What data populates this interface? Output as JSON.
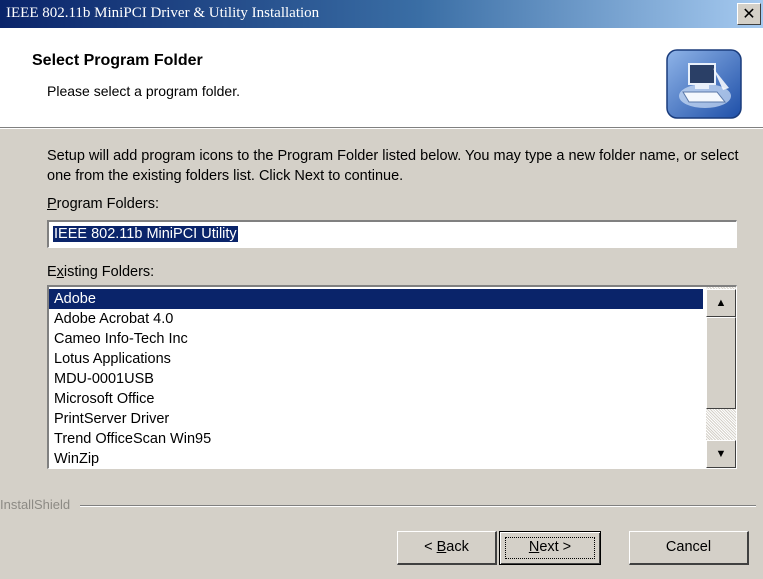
{
  "window": {
    "title": "IEEE 802.11b MiniPCI Driver & Utility Installation",
    "close_glyph": "✕"
  },
  "header": {
    "title": "Select Program Folder",
    "subtitle": "Please select a program folder.",
    "icon": "computer-setup-icon"
  },
  "intro": "Setup will add program icons to the Program Folder listed below.  You may type a new folder name, or select one from the existing folders list.  Click Next to continue.",
  "program_folder": {
    "label_mnemonic": "P",
    "label_rest": "rogram Folders:",
    "value": "IEEE 802.11b MiniPCI Utility"
  },
  "existing_folders": {
    "label_before": "E",
    "label_mnemonic": "x",
    "label_rest": "isting Folders:",
    "items": [
      "Adobe",
      "Adobe Acrobat 4.0",
      "Cameo Info-Tech Inc",
      "Lotus Applications",
      "MDU-0001USB",
      "Microsoft Office",
      "PrintServer Driver",
      "Trend OfficeScan Win95",
      "WinZip"
    ],
    "selected_index": 0,
    "scroll_up_glyph": "▲",
    "scroll_down_glyph": "▼"
  },
  "branding": "InstallShield",
  "buttons": {
    "back_prefix": "< ",
    "back_mnemonic": "B",
    "back_rest": "ack",
    "next_mnemonic": "N",
    "next_rest": "ext >",
    "cancel": "Cancel"
  },
  "colors": {
    "title_bar": "#0a246a",
    "selection": "#0a246a",
    "dialog_bg": "#d4d0c8"
  }
}
